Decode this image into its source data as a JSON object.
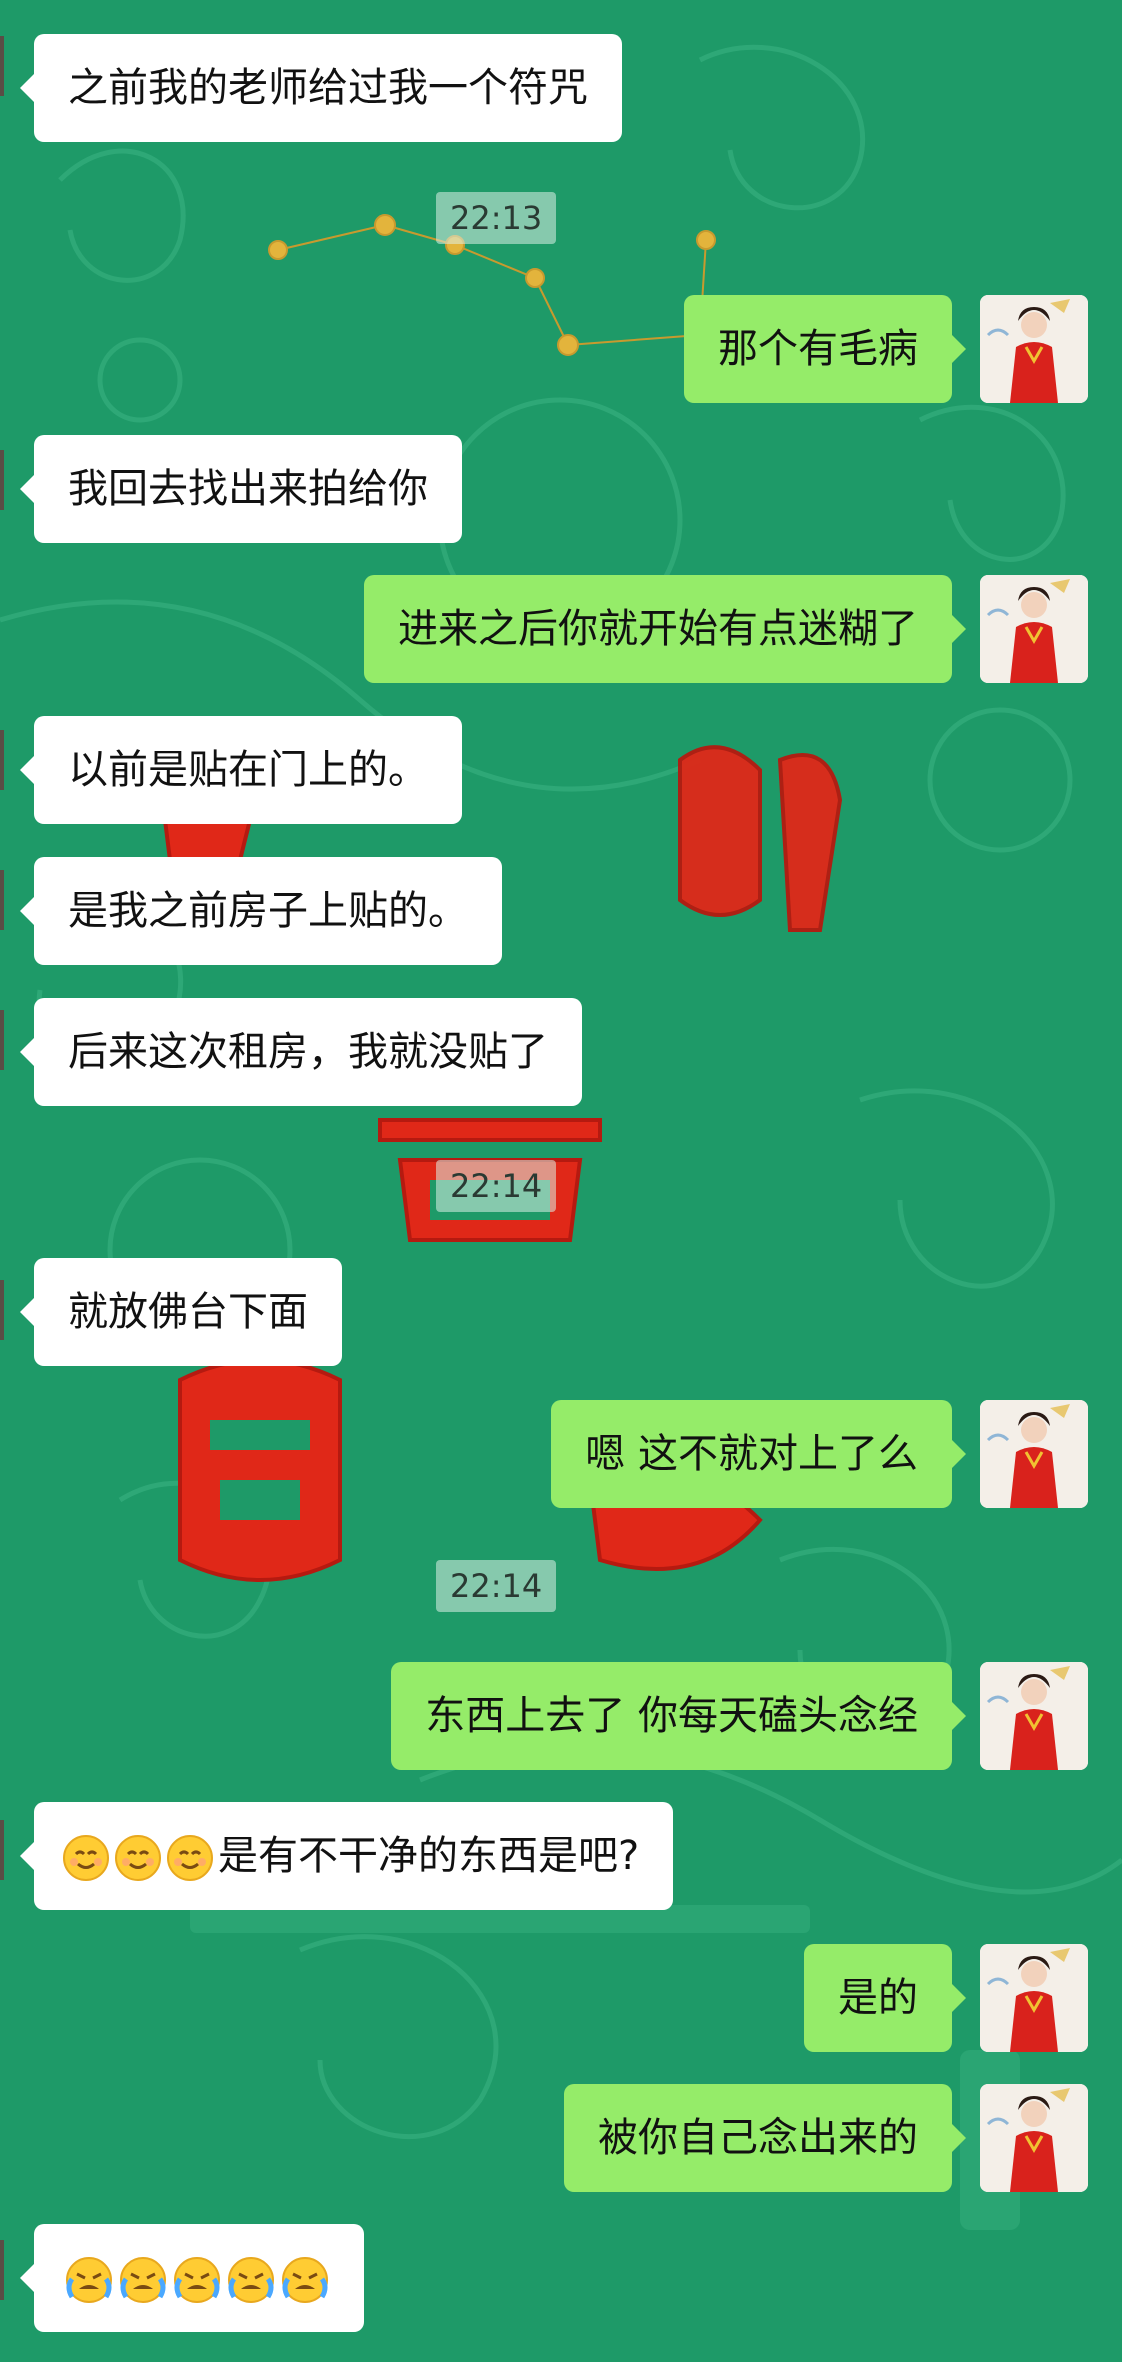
{
  "messages": [
    {
      "side": "left",
      "text": "之前我的老师给过我一个符咒"
    },
    {
      "side": "right",
      "text": "那个有毛病"
    },
    {
      "side": "left",
      "text": "我回去找出来拍给你"
    },
    {
      "side": "right",
      "text": "进来之后你就开始有点迷糊了"
    },
    {
      "side": "left",
      "text": "以前是贴在门上的。"
    },
    {
      "side": "left",
      "text": "是我之前房子上贴的。"
    },
    {
      "side": "left",
      "text": "后来这次租房，我就没贴了"
    },
    {
      "side": "left",
      "text": "就放佛台下面"
    },
    {
      "side": "right",
      "text": "嗯 这不就对上了么"
    },
    {
      "side": "right",
      "text": "东西上去了 你每天磕头念经"
    },
    {
      "side": "left",
      "text": "是有不干净的东西是吧?",
      "emoji_prefix": "smiling-face-icon",
      "emoji_count": 3
    },
    {
      "side": "right",
      "text": "是的"
    },
    {
      "side": "right",
      "text": "被你自己念出来的"
    },
    {
      "side": "left",
      "text": "",
      "emoji_prefix": "loudly-crying-face-icon",
      "emoji_count": 5
    }
  ],
  "timestamps": [
    "22:13",
    "22:14",
    "22:14"
  ],
  "colors": {
    "background": "#1e9a68",
    "bubble_self": "#95ec69",
    "bubble_other": "#ffffff",
    "seal_red": "#e02818"
  }
}
